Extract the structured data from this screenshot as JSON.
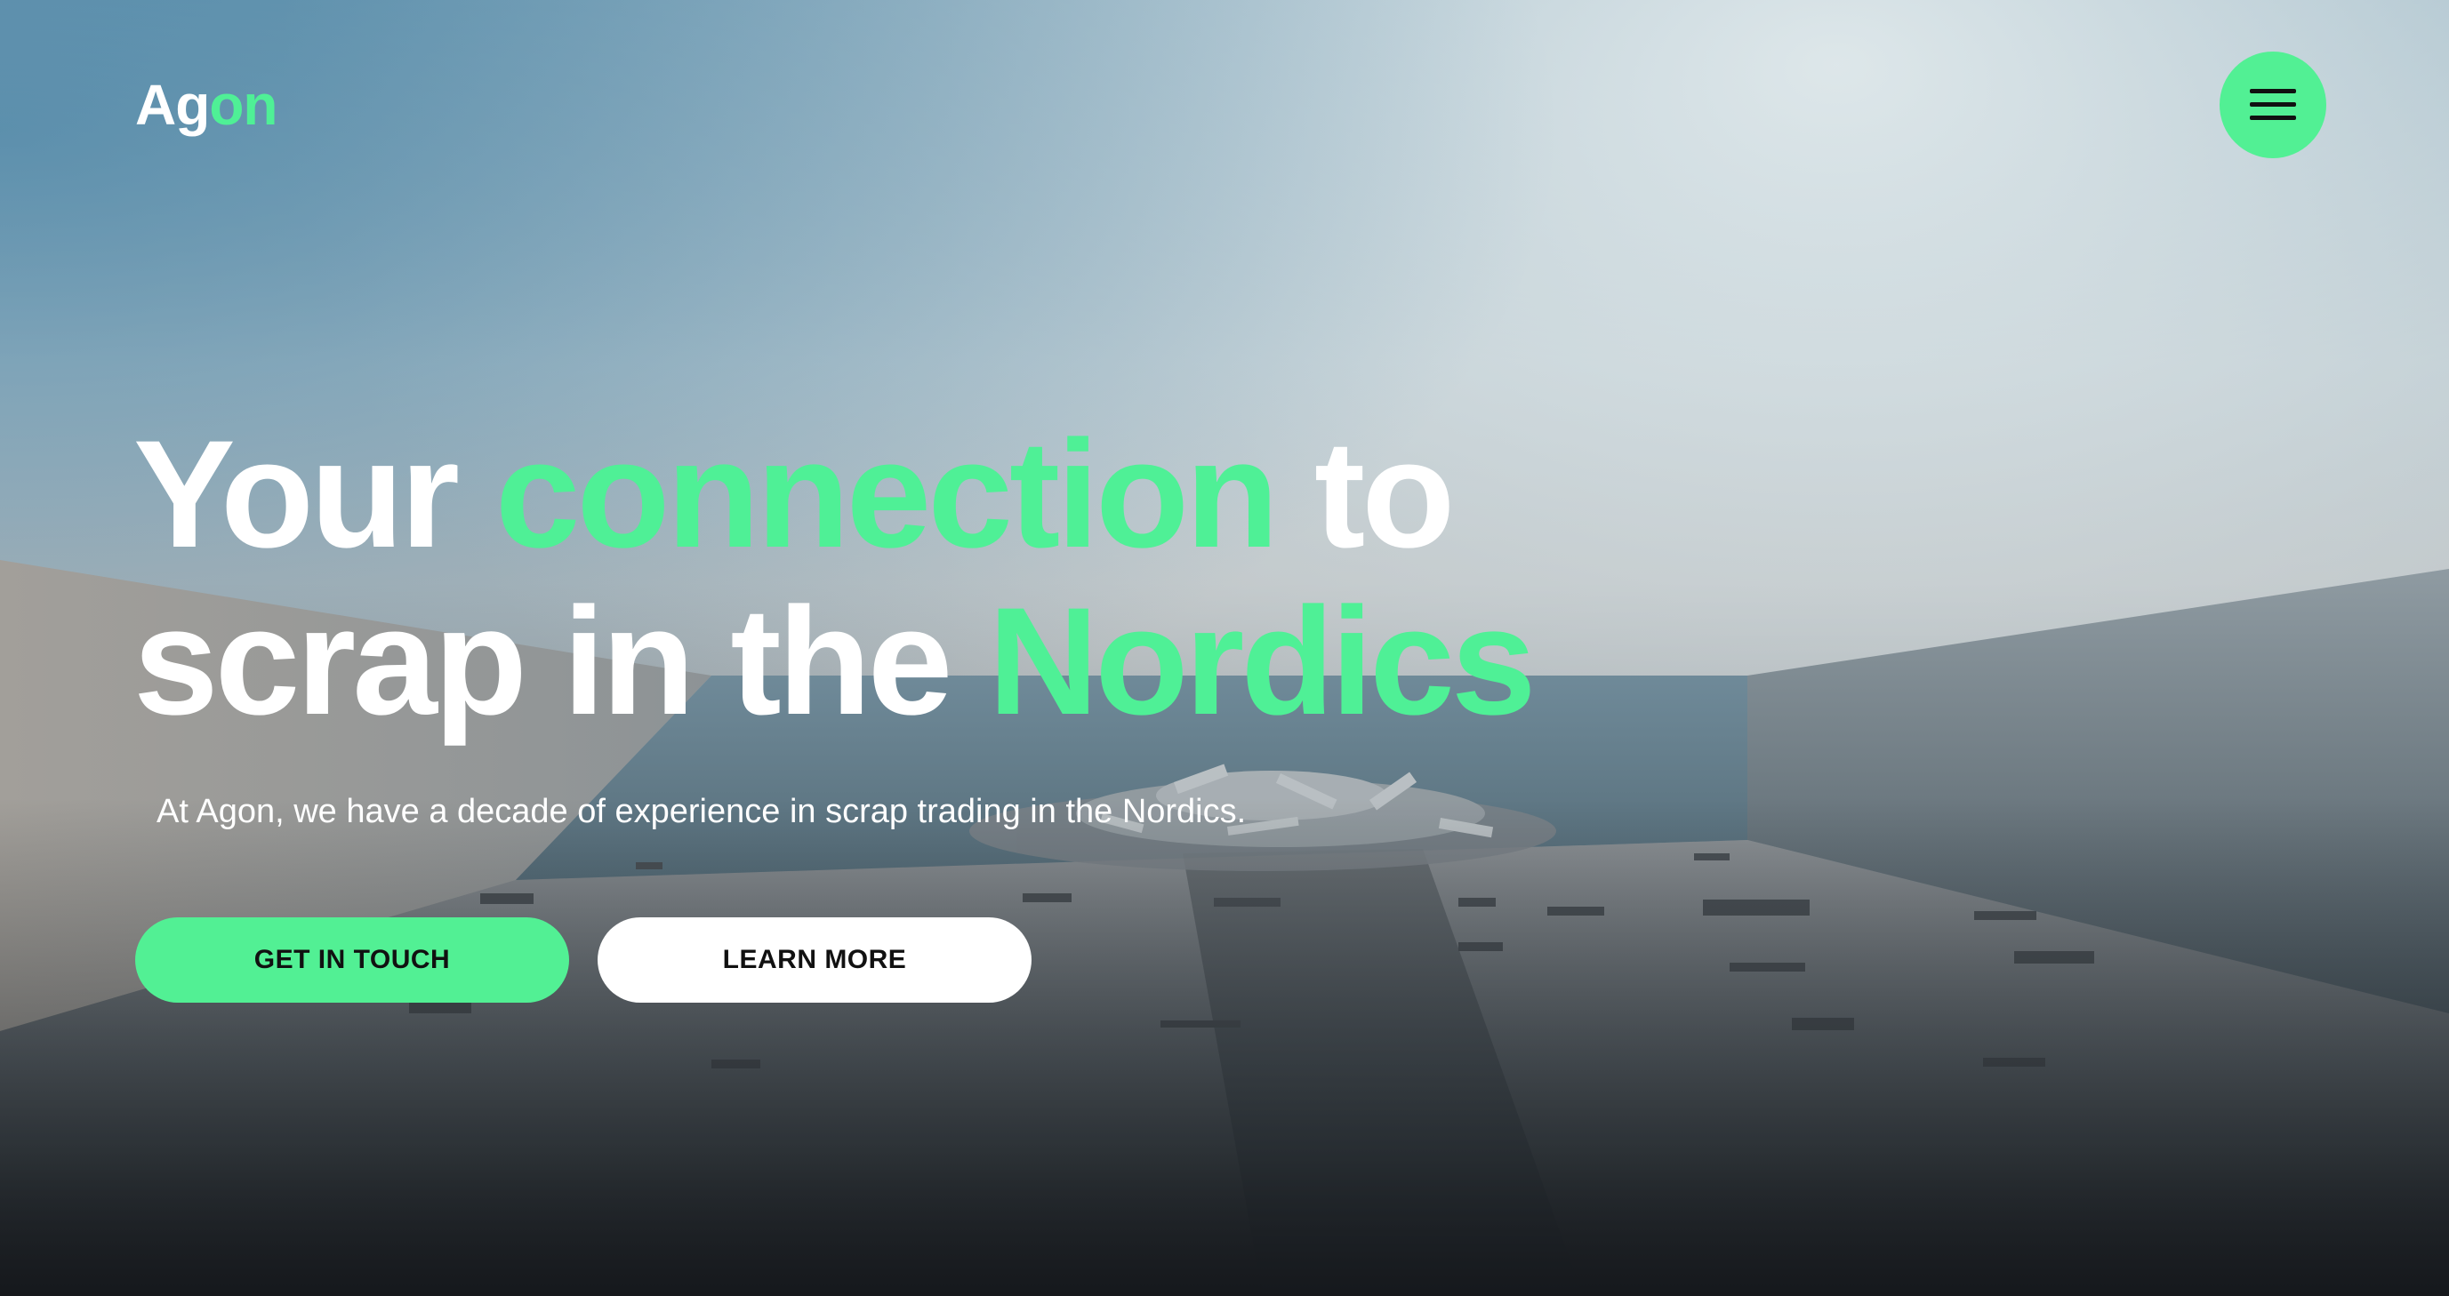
{
  "brand": {
    "logo_part1": "Ag",
    "logo_part2": "on"
  },
  "header": {
    "menu_icon": "hamburger-menu-icon"
  },
  "hero": {
    "headline_line1_part1": "Your ",
    "headline_line1_highlight": "connection",
    "headline_line1_part2": " to",
    "headline_line2_part1": "scrap in the ",
    "headline_line2_highlight": "Nordics",
    "subtitle": "At Agon, we have a decade of experience in scrap trading in the Nordics.",
    "cta_primary": "GET IN TOUCH",
    "cta_secondary": "LEARN MORE"
  },
  "colors": {
    "accent_green": "#52f094",
    "text_white": "#ffffff",
    "button_text": "#111111"
  }
}
